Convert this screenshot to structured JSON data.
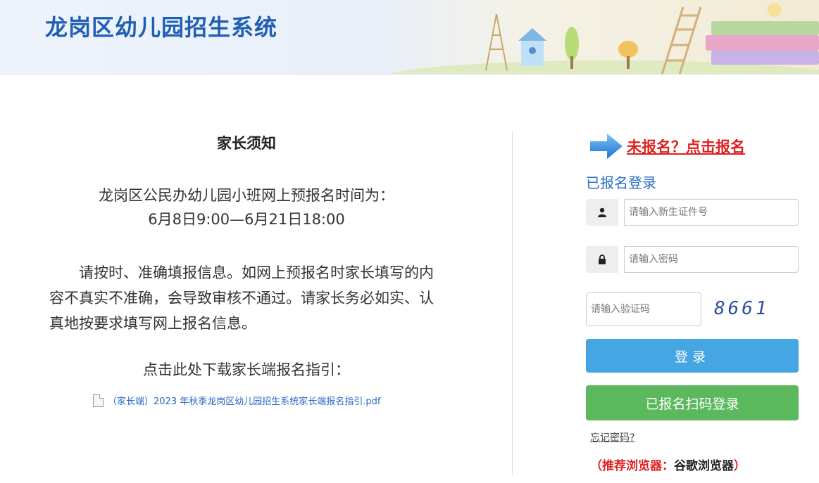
{
  "header": {
    "title": "龙岗区幼儿园招生系统"
  },
  "notice": {
    "title": "家长须知",
    "time_label": "龙岗区公民办幼儿园小班网上预报名时间为：",
    "time_range": "6月8日9:00—6月21日18:00",
    "paragraph": "请按时、准确填报信息。如网上预报名时家长填写的内容不真实不准确，会导致审核不通过。请家长务必如实、认真地按要求填写网上报名信息。",
    "download_label": "点击此处下载家长端报名指引：",
    "file_name": "（家长端）2023 年秋季龙岗区幼儿园招生系统家长端报名指引.pdf"
  },
  "login": {
    "register_link": "未报名？点击报名",
    "heading": "已报名登录",
    "id_placeholder": "请输入新生证件号",
    "password_placeholder": "请输入密码",
    "captcha_placeholder": "请输入验证码",
    "captcha_code": "8661",
    "login_button": "登录",
    "qr_login_button": "已报名扫码登录",
    "forgot_password": "忘记密码?",
    "browser_tip_label": "（推荐浏览器：",
    "browser_tip_name": "谷歌浏览器",
    "browser_tip_end": "）"
  },
  "icons": {
    "user": "user-icon",
    "lock": "lock-icon",
    "arrow": "arrow-right-icon",
    "file": "file-icon"
  },
  "colors": {
    "title_blue": "#1f5fb4",
    "link_red": "#e02020",
    "login_blue": "#45a6e3",
    "qr_green": "#5cb85c"
  }
}
